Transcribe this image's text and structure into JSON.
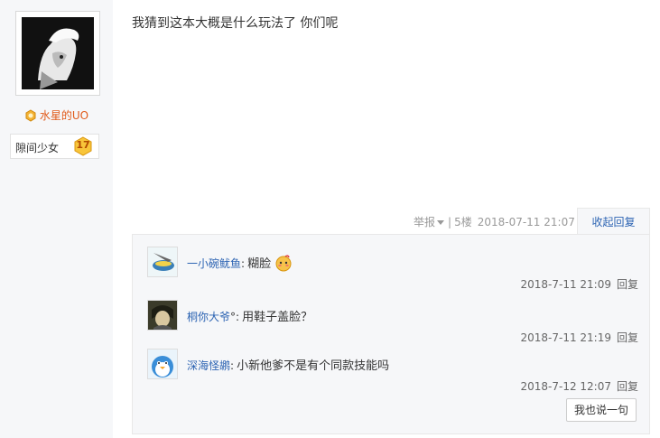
{
  "author": {
    "username": "水星的UO",
    "badge_name": "隙间少女",
    "badge_level": "17"
  },
  "post": {
    "content": "我猜到这本大概是什么玩法了 你们呢",
    "report_label": "举报",
    "floor": "5楼",
    "datetime": "2018-07-11 21:07",
    "collapse_label": "收起回复"
  },
  "replies": [
    {
      "user": "一小碗鱿鱼",
      "sep": ":",
      "text": "糊脸",
      "has_emoji": true,
      "time": "2018-7-11 21:09",
      "reply_label": "回复"
    },
    {
      "user": "桐你大爷",
      "sep": "°:",
      "text": "用鞋子盖脸？",
      "has_emoji": false,
      "time": "2018-7-11 21:19",
      "reply_label": "回复"
    },
    {
      "user": "深海怪鹕",
      "sep": ":",
      "text": "小新他爹不是有个同款技能吗",
      "has_emoji": false,
      "time": "2018-7-12 12:07",
      "reply_label": "回复"
    }
  ],
  "say_button_label": "我也说一句",
  "colors": {
    "link_blue": "#2d64b3",
    "username_orange": "#e05a1a",
    "panel_bg": "#f6f7f9"
  }
}
